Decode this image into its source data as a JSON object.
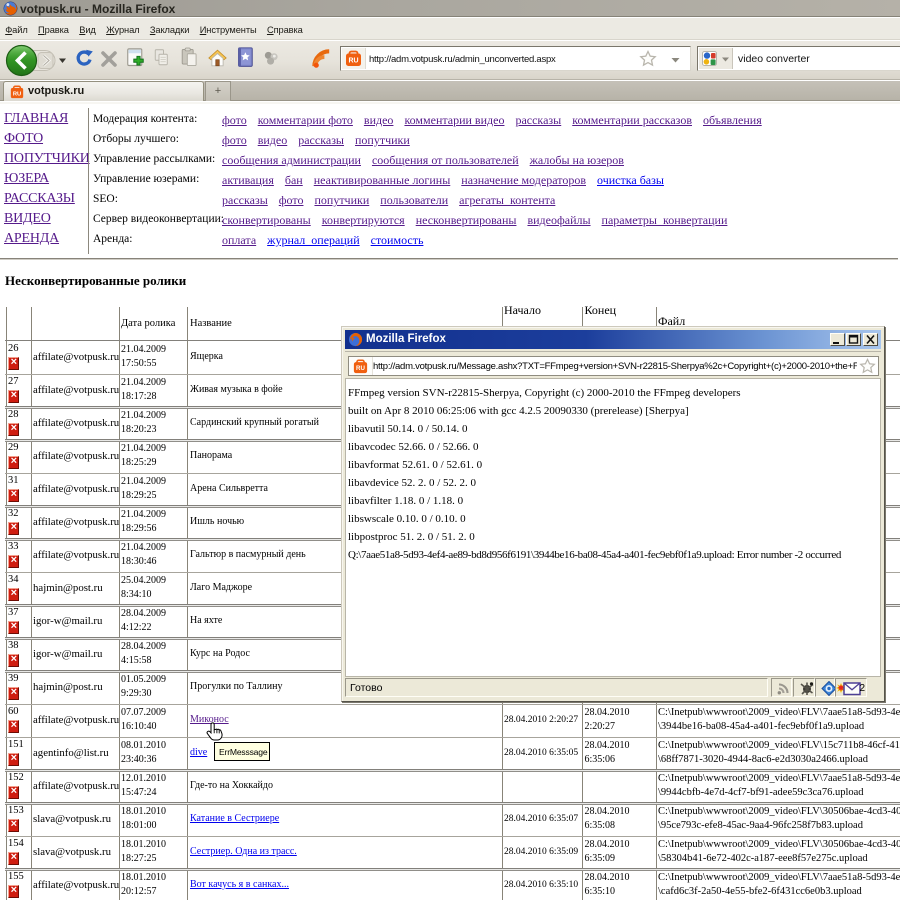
{
  "window": {
    "title": "votpusk.ru - Mozilla Firefox"
  },
  "menu": {
    "items": [
      "Файл",
      "Правка",
      "Вид",
      "Журнал",
      "Закладки",
      "Инструменты",
      "Справка"
    ]
  },
  "toolbar": {
    "url": "http://adm.votpusk.ru/admin_unconverted.aspx",
    "search_value": "video converter"
  },
  "tabbar": {
    "tab_label": "votpusk.ru",
    "newtab_label": "+"
  },
  "nav": {
    "items": [
      "ГЛАВНАЯ",
      "ФОТО",
      "ПОПУТЧИКИ",
      "ЮЗЕРА",
      "РАССКАЗЫ",
      "ВИДЕО",
      "АРЕНДА"
    ]
  },
  "admin_menu": [
    {
      "label": "Модерация контента:",
      "links": [
        {
          "text": "фото",
          "visited": true
        },
        {
          "text": "комментарии фото",
          "visited": true
        },
        {
          "text": "видео",
          "visited": true
        },
        {
          "text": "комментарии видео",
          "visited": true
        },
        {
          "text": "рассказы",
          "visited": true
        },
        {
          "text": "комментарии рассказов",
          "visited": true
        },
        {
          "text": "объявления",
          "visited": true
        }
      ]
    },
    {
      "label": "Отборы лучшего:",
      "links": [
        {
          "text": "фото",
          "visited": true
        },
        {
          "text": "видео",
          "visited": true
        },
        {
          "text": "рассказы",
          "visited": true
        },
        {
          "text": "попутчики",
          "visited": true
        }
      ]
    },
    {
      "label": "Управление рассылками:",
      "links": [
        {
          "text": "сообщения администрации",
          "visited": true
        },
        {
          "text": "сообщения от пользователей",
          "visited": true
        },
        {
          "text": "жалобы на юзеров",
          "visited": true
        }
      ]
    },
    {
      "label": "Управление юзерами:",
      "links": [
        {
          "text": "активация",
          "visited": true
        },
        {
          "text": "бан",
          "visited": true
        },
        {
          "text": "неактивированные логины",
          "visited": true
        },
        {
          "text": "назначение модераторов",
          "visited": true
        },
        {
          "text": "очистка базы",
          "visited": false
        }
      ]
    },
    {
      "label": "SEO:",
      "links": [
        {
          "text": "рассказы",
          "visited": true
        },
        {
          "text": "фото",
          "visited": true
        },
        {
          "text": "попутчики",
          "visited": true
        },
        {
          "text": "пользователи",
          "visited": true
        },
        {
          "text": "агрегаты_контента",
          "visited": true
        }
      ]
    },
    {
      "label": "Сервер видеоконвертации:",
      "links": [
        {
          "text": "сконвертированы",
          "visited": true
        },
        {
          "text": "конвертируются",
          "visited": true
        },
        {
          "text": "несконвертированы",
          "visited": true
        },
        {
          "text": "видеофайлы",
          "visited": true
        },
        {
          "text": "параметры_конвертации",
          "visited": true
        }
      ]
    },
    {
      "label": "Аренда:",
      "links": [
        {
          "text": "оплата",
          "visited": true
        },
        {
          "text": "журнал_операций",
          "visited": false
        },
        {
          "text": "стоимость",
          "visited": false
        }
      ]
    }
  ],
  "page": {
    "heading": "Несконвертированные ролики"
  },
  "table": {
    "headers": {
      "date": "Дата ролика",
      "name": "Название",
      "start": "Начало",
      "end": "Конец",
      "file": "Файл"
    },
    "rows": [
      {
        "num": "26",
        "email": "affilate@votpusk.ru",
        "d1": "21.04.2009",
        "d2": "17:50:55",
        "title": "Ящерка",
        "link": null,
        "start": "",
        "e1": "",
        "e2": "",
        "f1": "",
        "f2": "",
        "sep": "none"
      },
      {
        "num": "27",
        "email": "affilate@votpusk.ru",
        "d1": "21.04.2009",
        "d2": "18:17:28",
        "title": "Живая музыка в фойе",
        "link": null,
        "start": "",
        "e1": "",
        "e2": "",
        "f1": "",
        "f2": "",
        "sep": "light"
      },
      {
        "num": "28",
        "email": "affilate@votpusk.ru",
        "d1": "21.04.2009",
        "d2": "18:20:23",
        "title": "Сардинский крупный рогатый",
        "link": null,
        "start": "",
        "e1": "",
        "e2": "",
        "f1": "",
        "f2": "",
        "sep": "dark"
      },
      {
        "num": "29",
        "email": "affilate@votpusk.ru",
        "d1": "21.04.2009",
        "d2": "18:25:29",
        "title": "Панорама",
        "link": null,
        "start": "",
        "e1": "",
        "e2": "",
        "f1": "",
        "f2": "",
        "sep": "dark"
      },
      {
        "num": "31",
        "email": "affilate@votpusk.ru",
        "d1": "21.04.2009",
        "d2": "18:29:25",
        "title": "Арена Сильвретта",
        "link": null,
        "start": "",
        "e1": "",
        "e2": "",
        "f1": "",
        "f2": "",
        "sep": "light"
      },
      {
        "num": "32",
        "email": "affilate@votpusk.ru",
        "d1": "21.04.2009",
        "d2": "18:29:56",
        "title": "Ишль ночью",
        "link": null,
        "start": "",
        "e1": "",
        "e2": "",
        "f1": "",
        "f2": "",
        "sep": "dark"
      },
      {
        "num": "33",
        "email": "affilate@votpusk.ru",
        "d1": "21.04.2009",
        "d2": "18:30:46",
        "title": "Гальтюр в пасмурный день",
        "link": null,
        "start": "",
        "e1": "",
        "e2": "",
        "f1": "",
        "f2": "",
        "sep": "dark"
      },
      {
        "num": "34",
        "email": "hajmin@post.ru",
        "d1": "25.04.2009",
        "d2": "8:34:10",
        "title": "Лаго Маджоре",
        "link": null,
        "start": "",
        "e1": "",
        "e2": "",
        "f1": "",
        "f2": "",
        "sep": "light"
      },
      {
        "num": "37",
        "email": "igor-w@mail.ru",
        "d1": "28.04.2009",
        "d2": "4:12:22",
        "title": "На яхте",
        "link": null,
        "start": "",
        "e1": "",
        "e2": "",
        "f1": "",
        "f2": "",
        "sep": "dark"
      },
      {
        "num": "38",
        "email": "igor-w@mail.ru",
        "d1": "28.04.2009",
        "d2": "4:15:58",
        "title": "Курс на Родос",
        "link": null,
        "start": "",
        "e1": "",
        "e2": "",
        "f1": "",
        "f2": "",
        "sep": "dark"
      },
      {
        "num": "39",
        "email": "hajmin@post.ru",
        "d1": "01.05.2009",
        "d2": "9:29:30",
        "title": "Прогулки по Таллину",
        "link": null,
        "start": "",
        "e1": "",
        "e2": "",
        "f1": "",
        "f2": "",
        "sep": "dark"
      },
      {
        "num": "60",
        "email": "affilate@votpusk.ru",
        "d1": "07.07.2009",
        "d2": "16:10:40",
        "title": "Миконос",
        "link": "visited",
        "start": "28.04.2010 2:20:27",
        "e1": "28.04.2010",
        "e2": "2:20:27",
        "f1": "C:\\Inetpub\\wwwroot\\2009_video\\FLV\\7aae51a8-5d93-4e",
        "f2": "\\3944be16-ba08-45a4-a401-fec9ebf0f1a9.upload",
        "sep": "light"
      },
      {
        "num": "151",
        "email": "agentinfo@list.ru",
        "d1": "08.01.2010",
        "d2": "23:40:36",
        "title": "dive",
        "link": "unvisited",
        "start": "28.04.2010 6:35:05",
        "e1": "28.04.2010",
        "e2": "6:35:06",
        "f1": "C:\\Inetpub\\wwwroot\\2009_video\\FLV\\15c711b8-46cf-41",
        "f2": "\\68ff7871-3020-4944-8ac6-e2d3030a2466.upload",
        "sep": "light"
      },
      {
        "num": "152",
        "email": "affilate@votpusk.ru",
        "d1": "12.01.2010",
        "d2": "15:47:24",
        "title": "Где-то на Хоккайдо",
        "link": null,
        "start": "",
        "e1": "",
        "e2": "",
        "f1": "C:\\Inetpub\\wwwroot\\2009_video\\FLV\\7aae51a8-5d93-4e",
        "f2": "\\9944cbfb-4e7d-4cf7-bf91-adee59c3ca76.upload",
        "sep": "dark"
      },
      {
        "num": "153",
        "email": "slava@votpusk.ru",
        "d1": "18.01.2010",
        "d2": "18:01:00",
        "title": "Катание в Сестриере",
        "link": "unvisited",
        "start": "28.04.2010 6:35:07",
        "e1": "28.04.2010",
        "e2": "6:35:08",
        "f1": "C:\\Inetpub\\wwwroot\\2009_video\\FLV\\30506bae-4cd3-40",
        "f2": "\\95ce793c-efe8-45ac-9aa4-96fc258f7b83.upload",
        "sep": "dark"
      },
      {
        "num": "154",
        "email": "slava@votpusk.ru",
        "d1": "18.01.2010",
        "d2": "18:27:25",
        "title": "Сестриер. Одна из трасс.",
        "link": "unvisited",
        "start": "28.04.2010 6:35:09",
        "e1": "28.04.2010",
        "e2": "6:35:09",
        "f1": "C:\\Inetpub\\wwwroot\\2009_video\\FLV\\30506bae-4cd3-40",
        "f2": "\\58304b41-6e72-402c-a187-eee8f57e275c.upload",
        "sep": "light"
      },
      {
        "num": "155",
        "email": "affilate@votpusk.ru",
        "d1": "18.01.2010",
        "d2": "20:12:57",
        "title": "Вот качусь я в санках...",
        "link": "unvisited",
        "start": "28.04.2010 6:35:10",
        "e1": "28.04.2010",
        "e2": "6:35:10",
        "f1": "C:\\Inetpub\\wwwroot\\2009_video\\FLV\\7aae51a8-5d93-4e",
        "f2": "\\cafd6c3f-2a50-4e55-bfe2-6f431cc6e0b3.upload",
        "sep": "dark"
      }
    ]
  },
  "popup": {
    "title": "Mozilla Firefox",
    "url": "http://adm.votpusk.ru/Message.ashx?TXT=FFmpeg+version+SVN-r22815-Sherpya%2c+Copyright+(c)+2000-2010+the+F",
    "lines": [
      "FFmpeg version SVN-r22815-Sherpya, Copyright (c) 2000-2010 the FFmpeg developers",
      "built on Apr 8 2010 06:25:06 with gcc 4.2.5 20090330 (prerelease) [Sherpya]",
      "libavutil 50.14. 0 / 50.14. 0",
      "libavcodec 52.66. 0 / 52.66. 0",
      "libavformat 52.61. 0 / 52.61. 0",
      "libavdevice 52. 2. 0 / 52. 2. 0",
      "libavfilter 1.18. 0 / 1.18. 0",
      "libswscale 0.10. 0 / 0.10. 0",
      "libpostproc 51. 2. 0 / 51. 2. 0",
      "Q:\\7aae51a8-5d93-4ef4-ae89-bd8d956f6191\\3944be16-ba08-45a4-a401-fec9ebf0f1a9.upload: Error number -2 occurred"
    ],
    "status": "Готово",
    "mail_count": "2",
    "buttons": {
      "minimize": "_",
      "maximize": "□",
      "close": "×"
    }
  },
  "tooltip": {
    "text": "ErrMesssage"
  },
  "colors": {
    "visited_link": "#551A8B",
    "link": "#0000EE",
    "delete_red": "#cf1d10",
    "title_active_start": "#132e8e",
    "title_active_end": "#a5c3ea",
    "chrome_face": "#ece9d8",
    "tooltip_bg": "#ffffe1",
    "favicon_orange": "#f06010"
  }
}
